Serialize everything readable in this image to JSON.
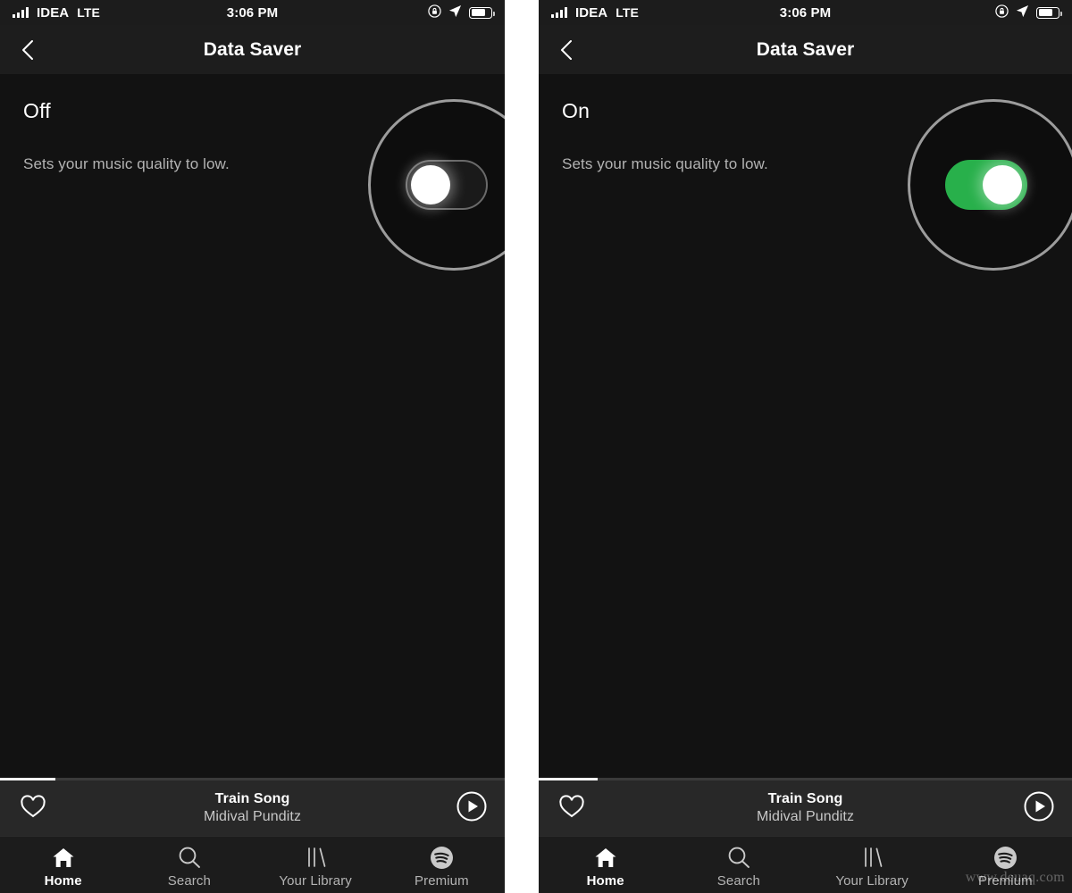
{
  "status_bar": {
    "carrier": "IDEA",
    "network": "LTE",
    "time": "3:06 PM",
    "icons": [
      "signal-bars-icon",
      "rotation-lock-icon",
      "location-arrow-icon",
      "battery-icon"
    ],
    "battery_percent": 72
  },
  "nav": {
    "title": "Data Saver",
    "back_icon": "chevron-left-icon"
  },
  "panels": [
    {
      "id": "left",
      "state_label": "Off",
      "description": "Sets your music quality to low.",
      "toggle_state": "off",
      "toggle_color": "#1a1a1a",
      "highlight": "magnifier-circle"
    },
    {
      "id": "right",
      "state_label": "On",
      "description": "Sets your music quality to low.",
      "toggle_state": "on",
      "toggle_color": "#28b04b",
      "highlight": "magnifier-circle"
    }
  ],
  "player": {
    "track": "Train Song",
    "artist": "Midival Punditz",
    "progress_percent": 11,
    "like_icon": "heart-outline-icon",
    "play_icon": "play-circle-icon"
  },
  "tabs": [
    {
      "label": "Home",
      "icon": "home-icon",
      "active": true
    },
    {
      "label": "Search",
      "icon": "search-icon",
      "active": false
    },
    {
      "label": "Your Library",
      "icon": "library-icon",
      "active": false
    },
    {
      "label": "Premium",
      "icon": "spotify-logo-icon",
      "active": false
    }
  ],
  "watermark": "www.deuaq.com",
  "colors": {
    "background": "#121212",
    "navbar": "#1d1d1d",
    "player": "#282828",
    "tabbar": "#1c1c1c",
    "accent_green": "#28b04b",
    "text_primary": "#ffffff",
    "text_secondary": "#b3b3b3",
    "halo_ring": "#9c9c9c"
  }
}
